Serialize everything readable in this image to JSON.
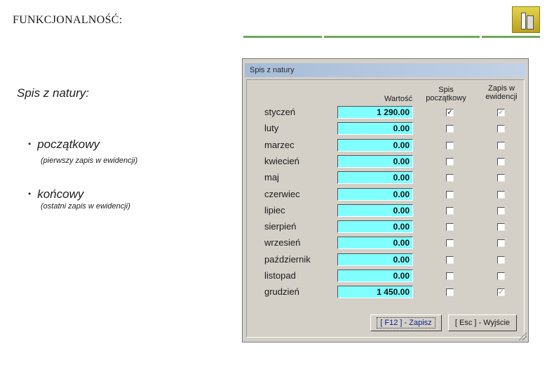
{
  "slide": {
    "title": "FUNKCJONALNOŚĆ:",
    "heading": "Spis z natury:",
    "bullets": [
      {
        "label": "początkowy",
        "note": "(pierwszy zapis w ewidencji)"
      },
      {
        "label": "końcowy",
        "note": "(ostatni zapis w ewidencji)"
      }
    ],
    "accent_color": "#6fa85a"
  },
  "dialog": {
    "title": "Spis z natury",
    "columns": {
      "value": "Wartość",
      "initial": [
        "Spis",
        "początkowy"
      ],
      "recorded": [
        "Zapis w",
        "ewidencji"
      ]
    },
    "rows": [
      {
        "month": "styczeń",
        "value": "1 290.00",
        "initial": true,
        "recorded": true
      },
      {
        "month": "luty",
        "value": "0.00",
        "initial": false,
        "recorded": false
      },
      {
        "month": "marzec",
        "value": "0.00",
        "initial": false,
        "recorded": false
      },
      {
        "month": "kwiecień",
        "value": "0.00",
        "initial": false,
        "recorded": false
      },
      {
        "month": "maj",
        "value": "0.00",
        "initial": false,
        "recorded": false
      },
      {
        "month": "czerwiec",
        "value": "0.00",
        "initial": false,
        "recorded": false
      },
      {
        "month": "lipiec",
        "value": "0.00",
        "initial": false,
        "recorded": false
      },
      {
        "month": "sierpień",
        "value": "0.00",
        "initial": false,
        "recorded": false
      },
      {
        "month": "wrzesień",
        "value": "0.00",
        "initial": false,
        "recorded": false
      },
      {
        "month": "październik",
        "value": "0.00",
        "initial": false,
        "recorded": false
      },
      {
        "month": "listopad",
        "value": "0.00",
        "initial": false,
        "recorded": false
      },
      {
        "month": "grudzień",
        "value": "1 450.00",
        "initial": false,
        "recorded": true
      }
    ],
    "buttons": {
      "save": "[ F12 ] - Zapisz",
      "exit": "[ Esc ] - Wyjście"
    },
    "value_field_color": "#80ffff",
    "titlebar_color": "#b4c8e0"
  }
}
